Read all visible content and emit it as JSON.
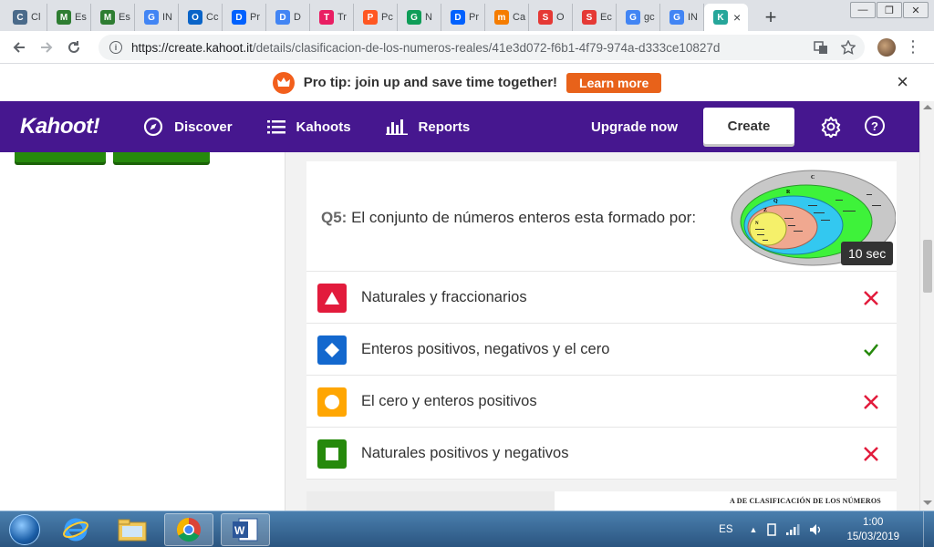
{
  "browser": {
    "tabs": [
      {
        "label": "Cl",
        "fav": "C",
        "color": "#4a6a8a"
      },
      {
        "label": "Es",
        "fav": "M",
        "color": "#2e7d32"
      },
      {
        "label": "Es",
        "fav": "M",
        "color": "#2e7d32"
      },
      {
        "label": "IN",
        "fav": "G",
        "color": "#4285f4"
      },
      {
        "label": "Cc",
        "fav": "O",
        "color": "#0a64c8"
      },
      {
        "label": "Pr",
        "fav": "D",
        "color": "#0061fe"
      },
      {
        "label": "D",
        "fav": "D",
        "color": "#4285f4"
      },
      {
        "label": "Tr",
        "fav": "T",
        "color": "#e91e63"
      },
      {
        "label": "Pc",
        "fav": "P",
        "color": "#ff5722"
      },
      {
        "label": "N",
        "fav": "G",
        "color": "#0f9d58"
      },
      {
        "label": "Pr",
        "fav": "D",
        "color": "#0061fe"
      },
      {
        "label": "Ca",
        "fav": "m",
        "color": "#f57c00"
      },
      {
        "label": "O",
        "fav": "S",
        "color": "#e53935"
      },
      {
        "label": "Ec",
        "fav": "S",
        "color": "#e53935"
      },
      {
        "label": "gc",
        "fav": "G",
        "color": "#4285f4"
      },
      {
        "label": "IN",
        "fav": "G",
        "color": "#4285f4"
      },
      {
        "label": "",
        "fav": "K",
        "color": "#26a69a"
      }
    ],
    "active_tab_close": "×",
    "new_tab": "+",
    "url_host": "https://create.kahoot.it",
    "url_path": "/details/clasificacion-de-los-numeros-reales/41e3d072-f6b1-4f79-974a-d333ce10827d"
  },
  "protip": {
    "text": "Pro tip: join up and save time together!",
    "button": "Learn more",
    "close": "×"
  },
  "nav": {
    "logo": "Kahoot!",
    "items": [
      "Discover",
      "Kahoots",
      "Reports"
    ],
    "upgrade": "Upgrade now",
    "create": "Create",
    "help": "?"
  },
  "question": {
    "number": "Q5:",
    "text": "El conjunto de números enteros esta formado por:",
    "time": "10 sec",
    "diagram_labels": {
      "c": "C",
      "r": "R",
      "q": "Q",
      "z": "Z",
      "n": "N"
    },
    "answers": [
      {
        "text": "Naturales y fraccionarios",
        "shape": "triangle",
        "color": "#e21b3c",
        "correct": false
      },
      {
        "text": "Enteros positivos, negativos y el cero",
        "shape": "diamond",
        "color": "#1368ce",
        "correct": true
      },
      {
        "text": "El cero y enteros positivos",
        "shape": "circle",
        "color": "#ffa602",
        "correct": false
      },
      {
        "text": "Naturales positivos y negativos",
        "shape": "square",
        "color": "#26890c",
        "correct": false
      }
    ]
  },
  "next_card_caption": "A DE CLASIFICACIÓN DE LOS NÚMEROS",
  "colors": {
    "kahoot_purple": "#46178f",
    "learn_orange": "#e8621a",
    "correct_green": "#26890c",
    "wrong_red": "#e21b3c"
  },
  "taskbar": {
    "lang": "ES",
    "time": "1:00",
    "date": "15/03/2019",
    "apps": [
      "internet-explorer",
      "file-explorer",
      "chrome",
      "word"
    ]
  }
}
